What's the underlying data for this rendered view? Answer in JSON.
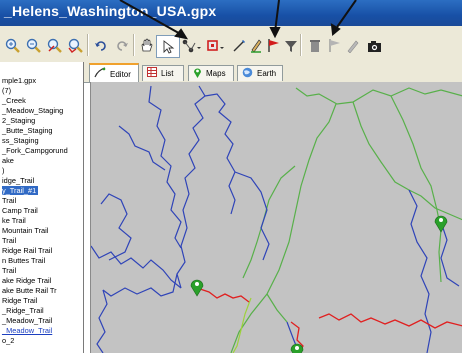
{
  "window": {
    "title": "_Helens_Washington_USA.gpx"
  },
  "toolbar": {
    "icons": [
      "zoom-in-icon",
      "zoom-out-icon",
      "zoom-fit-icon",
      "zoom-selection-icon",
      "undo-icon",
      "redo-icon",
      "pan-hand-icon",
      "select-arrow-icon",
      "route-tool-icon",
      "waypoint-tool-icon",
      "draw-track-icon",
      "pencil-track-icon",
      "red-flag-icon",
      "filter-icon",
      "trash-icon",
      "flag-gray-icon",
      "pencil-gray-icon",
      "camera-icon"
    ]
  },
  "sidebar": {
    "items": [
      {
        "label": "mple1.gpx"
      },
      {
        "label": "(7)"
      },
      {
        "label": "_Creek"
      },
      {
        "label": "_Meadow_Staging"
      },
      {
        "label": "2_Staging"
      },
      {
        "label": "_Butte_Staging"
      },
      {
        "label": "ss_Staging"
      },
      {
        "label": "_Fork_Campgorund"
      },
      {
        "label": "ake"
      },
      {
        "label": ")"
      },
      {
        "label": "idge_Trail"
      },
      {
        "label": "y_Trail_#1"
      },
      {
        "label": "Trail"
      },
      {
        "label": "Camp Trail"
      },
      {
        "label": "ke Trail"
      },
      {
        "label": "Mountain Trail"
      },
      {
        "label": "Trail"
      },
      {
        "label": "Ridge Rail Trail"
      },
      {
        "label": "n Buttes Trail"
      },
      {
        "label": "Trail"
      },
      {
        "label": "ake Ridge Trail"
      },
      {
        "label": "ake Butte Rail Tr"
      },
      {
        "label": "Ridge Trail"
      },
      {
        "label": "_Ridge_Trail"
      },
      {
        "label": "_Meadow_Trail"
      },
      {
        "label": "_Meadow_Trail"
      },
      {
        "label": "o_2"
      }
    ]
  },
  "tabs": [
    {
      "label": "Editor"
    },
    {
      "label": "List"
    },
    {
      "label": "Maps"
    },
    {
      "label": "Earth"
    }
  ],
  "colors": {
    "map_background": "#c3c3c3",
    "track_blue": "#2f44b8",
    "track_green": "#58b04a",
    "track_red": "#e02020",
    "track_lime": "#9ed23a",
    "waypoint": "#2aa02a"
  }
}
